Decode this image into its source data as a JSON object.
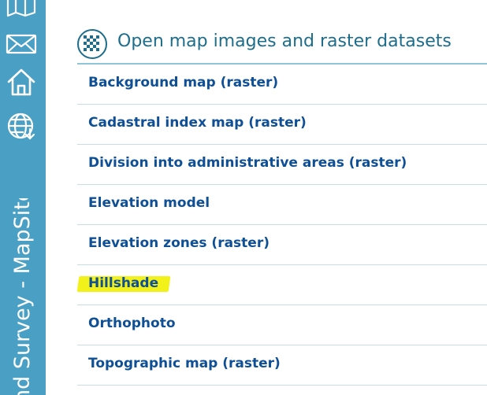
{
  "app": {
    "title": "Land Survey - MapSite",
    "visible_title": "nd Survey - MapSite"
  },
  "colors": {
    "sidebar": "#4a9fc5",
    "accent": "#1d6d8c",
    "link": "#0e4f95",
    "highlight": "#f2f21a"
  },
  "sidebar": {
    "icons": [
      {
        "name": "map-icon"
      },
      {
        "name": "mail-icon"
      },
      {
        "name": "home-icon"
      },
      {
        "name": "globe-download-icon"
      }
    ]
  },
  "section": {
    "title": "Open map images and raster datasets",
    "icon": "checkerboard-icon"
  },
  "items": [
    {
      "label": "Background map (raster)"
    },
    {
      "label": "Cadastral index map (raster)"
    },
    {
      "label": "Division into administrative areas (raster)"
    },
    {
      "label": "Elevation model"
    },
    {
      "label": "Elevation zones (raster)"
    },
    {
      "label": "Hillshade",
      "highlighted": true
    },
    {
      "label": "Orthophoto"
    },
    {
      "label": "Topographic map (raster)"
    }
  ]
}
